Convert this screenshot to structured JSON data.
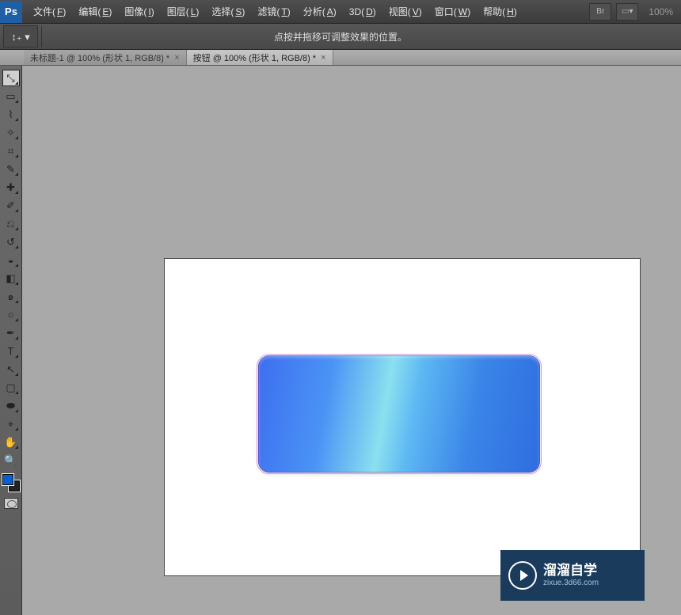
{
  "app": {
    "logo": "Ps"
  },
  "menu": [
    {
      "label": "文件(",
      "key": "F",
      "suffix": ")"
    },
    {
      "label": "编辑(",
      "key": "E",
      "suffix": ")"
    },
    {
      "label": "图像(",
      "key": "I",
      "suffix": ")"
    },
    {
      "label": "图层(",
      "key": "L",
      "suffix": ")"
    },
    {
      "label": "选择(",
      "key": "S",
      "suffix": ")"
    },
    {
      "label": "滤镜(",
      "key": "T",
      "suffix": ")"
    },
    {
      "label": "分析(",
      "key": "A",
      "suffix": ")"
    },
    {
      "label": "3D(",
      "key": "D",
      "suffix": ")"
    },
    {
      "label": "视图(",
      "key": "V",
      "suffix": ")"
    },
    {
      "label": "窗口(",
      "key": "W",
      "suffix": ")"
    },
    {
      "label": "帮助(",
      "key": "H",
      "suffix": ")"
    }
  ],
  "menubar_right": {
    "br": "Br",
    "screen": "▭▾",
    "zoom": "100%"
  },
  "options": {
    "preset_icon": "↕₊ ▾",
    "hint": "点按并拖移可调整效果的位置。"
  },
  "tabs": [
    {
      "label": "未标题-1 @ 100% (形状 1, RGB/8) *",
      "active": false
    },
    {
      "label": "按钮 @ 100% (形状 1, RGB/8) *",
      "active": true
    }
  ],
  "tools": [
    {
      "name": "move-tool",
      "glyph": "⤡",
      "active": true,
      "flyout": true
    },
    {
      "name": "marquee-tool",
      "glyph": "▭",
      "flyout": true
    },
    {
      "name": "lasso-tool",
      "glyph": "⌇",
      "flyout": true
    },
    {
      "name": "magic-wand-tool",
      "glyph": "✧",
      "flyout": true
    },
    {
      "name": "crop-tool",
      "glyph": "⌗",
      "flyout": true
    },
    {
      "name": "eyedropper-tool",
      "glyph": "✎",
      "flyout": true
    },
    {
      "name": "healing-brush-tool",
      "glyph": "✚",
      "flyout": true
    },
    {
      "name": "brush-tool",
      "glyph": "✐",
      "flyout": true
    },
    {
      "name": "clone-stamp-tool",
      "glyph": "⎌",
      "flyout": true
    },
    {
      "name": "history-brush-tool",
      "glyph": "↺",
      "flyout": true
    },
    {
      "name": "eraser-tool",
      "glyph": "◒",
      "flyout": true
    },
    {
      "name": "gradient-tool",
      "glyph": "◧",
      "flyout": true
    },
    {
      "name": "blur-tool",
      "glyph": "๑",
      "flyout": true
    },
    {
      "name": "dodge-tool",
      "glyph": "○",
      "flyout": true
    },
    {
      "name": "pen-tool",
      "glyph": "✒",
      "flyout": true
    },
    {
      "name": "type-tool",
      "glyph": "T",
      "flyout": true
    },
    {
      "name": "path-selection-tool",
      "glyph": "↖",
      "flyout": true
    },
    {
      "name": "rectangle-shape-tool",
      "glyph": "▢",
      "flyout": true
    },
    {
      "name": "3d-tool",
      "glyph": "⬬",
      "flyout": true
    },
    {
      "name": "3d-camera-tool",
      "glyph": "⌖",
      "flyout": true
    },
    {
      "name": "hand-tool",
      "glyph": "✋",
      "flyout": true
    },
    {
      "name": "zoom-tool",
      "glyph": "🔍",
      "flyout": false
    }
  ],
  "colors": {
    "foreground": "#0a5fd0",
    "background": "#222222"
  },
  "watermark": {
    "title": "溜溜自学",
    "sub": "zixue.3d66.com"
  }
}
